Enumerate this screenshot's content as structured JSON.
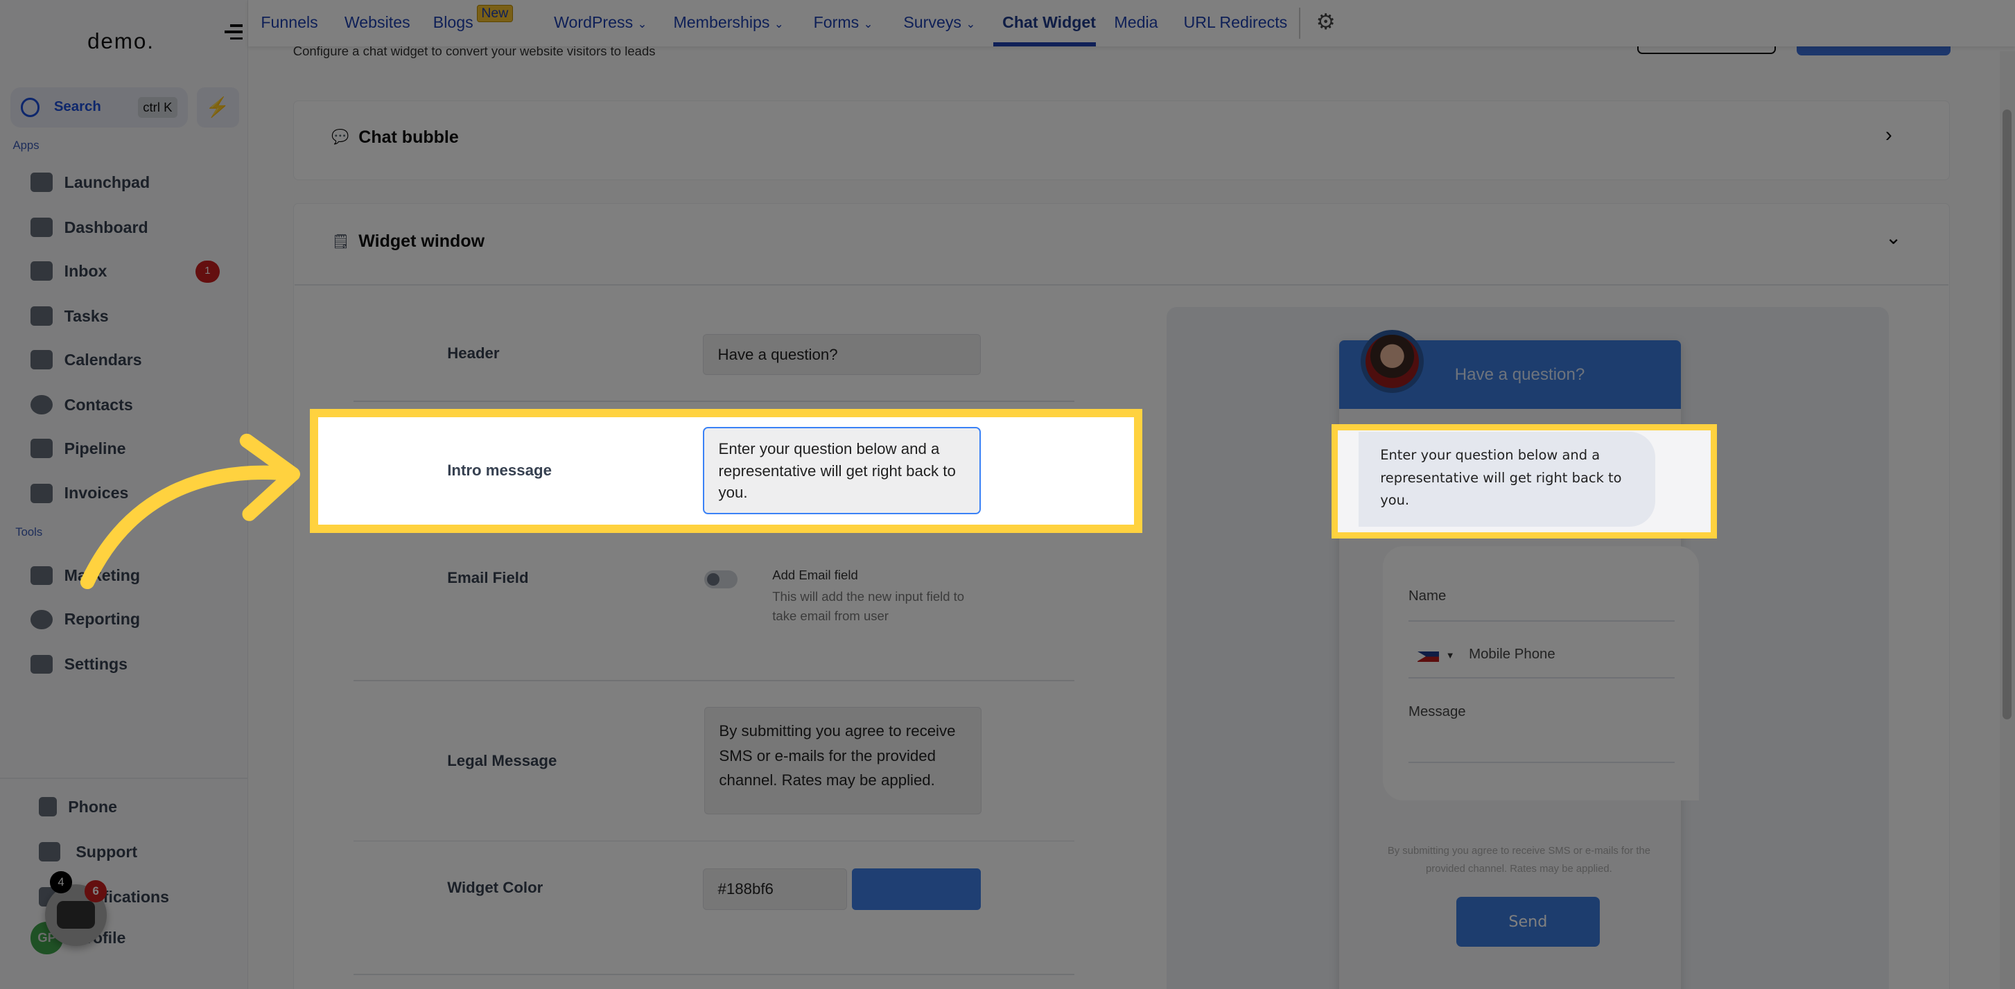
{
  "sidebar": {
    "logo": "demo.",
    "search_label": "Search",
    "search_shortcut": "ctrl K",
    "apps_label": "Apps",
    "tools_label": "Tools",
    "apps": [
      {
        "label": "Launchpad"
      },
      {
        "label": "Dashboard"
      },
      {
        "label": "Inbox",
        "badge": "1"
      },
      {
        "label": "Tasks"
      },
      {
        "label": "Calendars"
      },
      {
        "label": "Contacts"
      },
      {
        "label": "Pipeline"
      },
      {
        "label": "Invoices"
      }
    ],
    "tools": [
      {
        "label": "Marketing"
      },
      {
        "label": "Reporting"
      },
      {
        "label": "Settings"
      }
    ],
    "bottom": [
      {
        "label": "Phone"
      },
      {
        "label": "Support"
      },
      {
        "label": "Notifications"
      },
      {
        "label": "Profile"
      }
    ],
    "avatar_initials": "GP",
    "chat_fab_badge": "6",
    "notifications_badge": "4"
  },
  "topnav": {
    "items": [
      {
        "label": "Funnels"
      },
      {
        "label": "Websites"
      },
      {
        "label": "Blogs",
        "badge": "New"
      },
      {
        "label": "WordPress",
        "dropdown": true
      },
      {
        "label": "Memberships",
        "dropdown": true
      },
      {
        "label": "Forms",
        "dropdown": true
      },
      {
        "label": "Surveys",
        "dropdown": true
      },
      {
        "label": "Chat Widget",
        "active": true
      },
      {
        "label": "Media"
      },
      {
        "label": "URL Redirects"
      }
    ]
  },
  "page": {
    "subtitle": "Configure a chat widget to convert your website visitors to leads"
  },
  "chat_bubble": {
    "title": "Chat bubble"
  },
  "widget_window": {
    "title": "Widget window",
    "header_label": "Header",
    "header_value": "Have a question?",
    "intro_label": "Intro message",
    "intro_value": "Enter your question below and a representative will get right back to you.",
    "email_label": "Email Field",
    "email_toggle_label": "Add Email field",
    "email_toggle_desc": "This will add the new input field to take email from user",
    "email_enabled": false,
    "legal_label": "Legal Message",
    "legal_value": "By submitting you agree to receive SMS or e-mails for the provided channel. Rates may be applied.",
    "color_label": "Widget Color",
    "color_value": "#188bf6"
  },
  "preview": {
    "header": "Have a question?",
    "intro": "Enter your question below and a representative will get right back to you.",
    "name_placeholder": "Name",
    "phone_placeholder": "Mobile Phone",
    "message_placeholder": "Message",
    "legal": "By submitting you agree to receive SMS or e-mails for the provided channel. Rates may be applied.",
    "send_label": "Send"
  },
  "colors": {
    "highlight": "#ffd23f",
    "widget": "#188bf6"
  }
}
